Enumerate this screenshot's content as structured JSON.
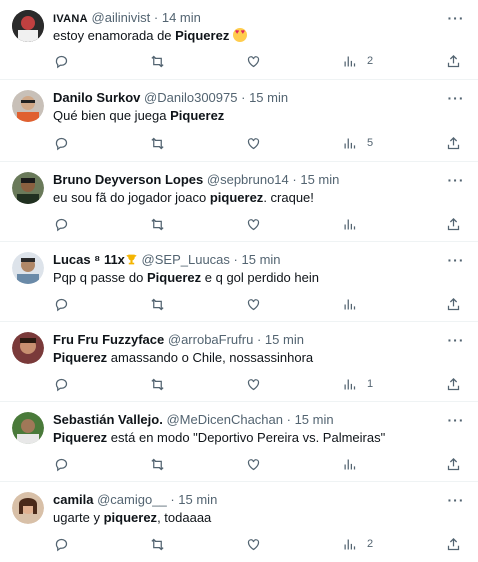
{
  "tweets": [
    {
      "name": "IVANA",
      "handle": "@ailinivist",
      "dot": "·",
      "time": "14 min",
      "text_pre": "estoy enamorada de ",
      "text_bold": "Piquerez",
      "text_post": " ",
      "text_bold2": "",
      "text_post2": "",
      "emoji": "heart-eyes-emoji",
      "views": "2",
      "avatar_color": "#2b2b2b"
    },
    {
      "name": "Danilo Surkov",
      "handle": "@Danilo300975",
      "dot": "·",
      "time": "15 min",
      "text_pre": "Qué bien que juega ",
      "text_bold": "Piquerez",
      "text_post": "",
      "views": "5",
      "avatar_color": "#8a7a6a"
    },
    {
      "name": "Bruno Deyverson Lopes",
      "handle": "@sepbruno14",
      "dot": "·",
      "time": "15 min",
      "text_pre": "eu sou fã do jogador joaco ",
      "text_bold": "piquerez",
      "text_post": ". craque!",
      "views": "",
      "avatar_color": "#4a3a2a"
    },
    {
      "name": "Lucas ⁸ 11x",
      "handle": "@SEP_Luucas",
      "dot": "·",
      "time": "15 min",
      "text_pre": "Pqp q passe do ",
      "text_bold": "Piquerez",
      "text_post": " e q gol perdido hein",
      "views": "",
      "avatar_color": "#9aa5b0"
    },
    {
      "name": "Fru Fru Fuzzyface",
      "handle": "@arrobaFrufru",
      "dot": "·",
      "time": "15 min",
      "text_pre": "",
      "text_bold": "Piquerez",
      "text_post": " amassando o Chile, nossassinhora",
      "views": "1",
      "avatar_color": "#5a3a2a"
    },
    {
      "name": "Sebastián Vallejo.",
      "handle": "@MeDicenChachan",
      "dot": "·",
      "time": "15 min",
      "text_pre": "",
      "text_bold": "Piquerez",
      "text_post": " está en modo \"Deportivo Pereira vs. Palmeiras\"",
      "views": "",
      "avatar_color": "#3a6a2a"
    },
    {
      "name": "camila",
      "handle": "@camigo__",
      "dot": "·",
      "time": "15 min",
      "text_pre": "ugarte y ",
      "text_bold": "piquerez",
      "text_post": ", todaaaa",
      "views": "2",
      "avatar_color": "#b08a70"
    }
  ],
  "more_label": "···",
  "colors": {
    "text": "#0f1419",
    "muted": "#536471",
    "divider": "#eff3f4"
  },
  "icons": [
    "reply-icon",
    "retweet-icon",
    "like-icon",
    "views-icon",
    "share-icon",
    "more-icon"
  ]
}
